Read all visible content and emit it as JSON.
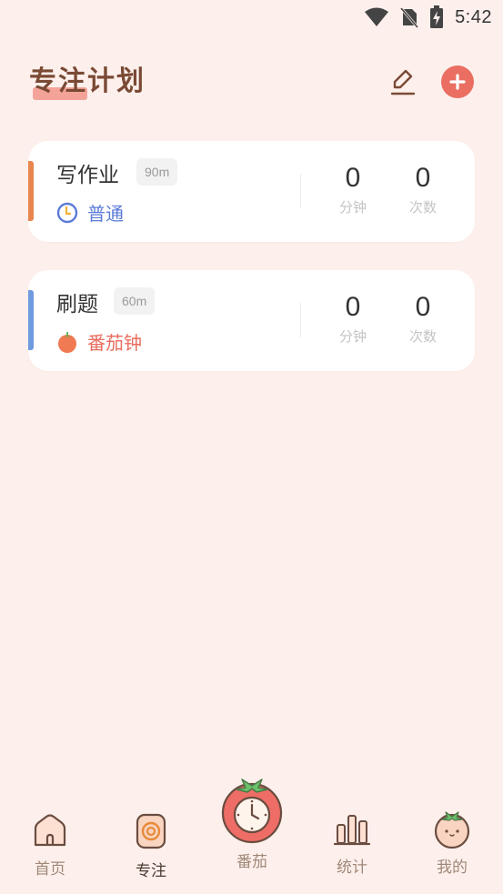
{
  "status_bar": {
    "time": "5:42"
  },
  "header": {
    "title": "专注计划"
  },
  "plans": [
    {
      "name": "写作业",
      "duration": "90m",
      "mode": "普通",
      "mode_icon": "clock-icon",
      "accent_color": "#e8864e",
      "mode_color": "#5a7bd8",
      "minutes": "0",
      "minutes_label": "分钟",
      "count": "0",
      "count_label": "次数"
    },
    {
      "name": "刷题",
      "duration": "60m",
      "mode": "番茄钟",
      "mode_icon": "tomato-icon",
      "accent_color": "#6f9ae0",
      "mode_color": "#e86c5e",
      "minutes": "0",
      "minutes_label": "分钟",
      "count": "0",
      "count_label": "次数"
    }
  ],
  "nav": {
    "items": [
      {
        "label": "首页",
        "icon": "home-icon"
      },
      {
        "label": "专注",
        "icon": "focus-icon",
        "active": true
      },
      {
        "label": "番茄",
        "icon": "tomato-timer-icon"
      },
      {
        "label": "统计",
        "icon": "stats-icon"
      },
      {
        "label": "我的",
        "icon": "profile-icon"
      }
    ]
  },
  "colors": {
    "background": "#fdf0ec",
    "title": "#7a4a35",
    "add_button": "#ea6e62",
    "tomato": "#e86c5e"
  }
}
